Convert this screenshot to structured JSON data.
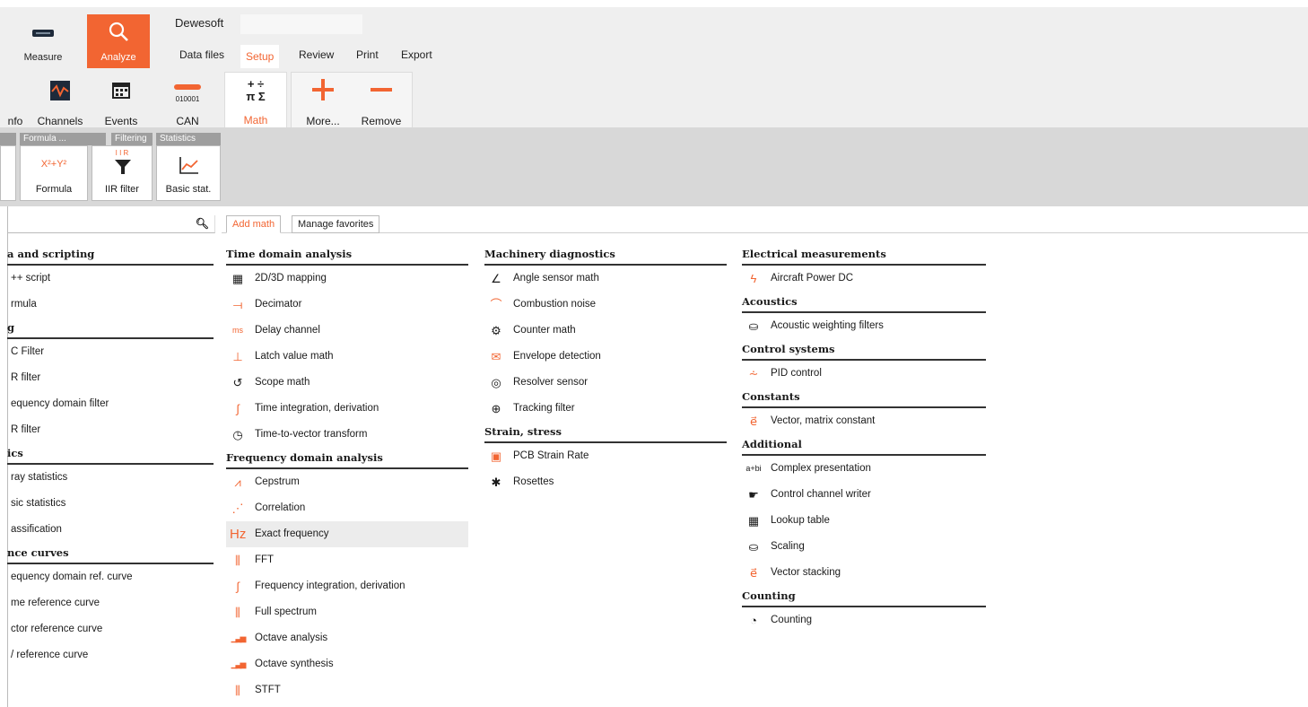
{
  "app": {
    "title": "Dewesoft"
  },
  "modes": [
    {
      "label": "Measure",
      "icon": "measure-icon"
    },
    {
      "label": "Analyze",
      "icon": "search-icon"
    }
  ],
  "menu_tabs": [
    "Data files",
    "Setup",
    "Review",
    "Print",
    "Export"
  ],
  "active_menu_tab": "Setup",
  "toolbar": {
    "info": "nfo",
    "channels": "Channels",
    "events": "Events",
    "can": "CAN",
    "can_sub": "010001",
    "math": "Math",
    "more": "More...",
    "remove": "Remove"
  },
  "ribbon_groups": {
    "formula_hdr": "Formula ...",
    "filtering_hdr": "Filtering",
    "statistics_hdr": "Statistics",
    "formula": "Formula",
    "formula_sym": "X²+Y²",
    "iir": "IIR filter",
    "iir_sym": "I I R",
    "basic": "Basic stat."
  },
  "tabs": {
    "add_math": "Add math",
    "manage_favorites": "Manage favorites"
  },
  "accent": "#f26532",
  "columns": [
    {
      "sections": [
        {
          "title": "a and scripting",
          "items": [
            "++ script",
            "rmula"
          ]
        },
        {
          "title": "g",
          "items": [
            "C Filter",
            "R filter",
            "equency domain filter",
            "R filter"
          ]
        },
        {
          "title": "ics",
          "items": [
            "ray statistics",
            "sic statistics",
            "assification"
          ]
        },
        {
          "title": "nce curves",
          "items": [
            "equency domain ref. curve",
            "me reference curve",
            "ctor reference curve",
            "/ reference curve"
          ]
        }
      ]
    },
    {
      "sections": [
        {
          "title": "Time domain analysis",
          "items": [
            "2D/3D mapping",
            "Decimator",
            "Delay channel",
            "Latch value math",
            "Scope math",
            "Time integration, derivation",
            "Time-to-vector transform"
          ]
        },
        {
          "title": "Frequency domain analysis",
          "items": [
            "Cepstrum",
            "Correlation",
            "Exact frequency",
            "FFT",
            "Frequency integration, derivation",
            "Full spectrum",
            "Octave analysis",
            "Octave synthesis",
            "STFT"
          ]
        }
      ]
    },
    {
      "sections": [
        {
          "title": "Machinery diagnostics",
          "items": [
            "Angle sensor math",
            "Combustion noise",
            "Counter math",
            "Envelope detection",
            "Resolver sensor",
            "Tracking filter"
          ]
        },
        {
          "title": "Strain, stress",
          "items": [
            "PCB Strain Rate",
            "Rosettes"
          ]
        }
      ]
    },
    {
      "sections": [
        {
          "title": "Electrical measurements",
          "items": [
            "Aircraft Power DC"
          ]
        },
        {
          "title": "Acoustics",
          "items": [
            "Acoustic weighting filters"
          ]
        },
        {
          "title": "Control systems",
          "items": [
            "PID control"
          ]
        },
        {
          "title": "Constants",
          "items": [
            "Vector, matrix constant"
          ]
        },
        {
          "title": "Additional",
          "items": [
            "Complex presentation",
            "Control channel writer",
            "Lookup table",
            "Scaling",
            "Vector stacking"
          ]
        },
        {
          "title": "Counting",
          "items": [
            "Counting"
          ]
        }
      ]
    }
  ],
  "selected_item": "Exact frequency",
  "icon_map": {
    "2D/3D mapping": [
      "grid-icon",
      "▦"
    ],
    "Decimator": [
      "decimator-icon",
      "⟞"
    ],
    "Delay channel": [
      "delay-icon",
      "ms"
    ],
    "Latch value math": [
      "latch-icon",
      "⊥"
    ],
    "Scope math": [
      "scope-icon",
      "↺"
    ],
    "Time integration, derivation": [
      "integral-icon",
      "∫"
    ],
    "Time-to-vector transform": [
      "clock-icon",
      "◷"
    ],
    "Cepstrum": [
      "cepstrum-icon",
      "⩘"
    ],
    "Correlation": [
      "correlation-icon",
      "⋰"
    ],
    "Exact frequency": [
      "hz-icon",
      "Hz"
    ],
    "FFT": [
      "fft-icon",
      "⫼"
    ],
    "Frequency integration, derivation": [
      "integral-icon",
      "∫"
    ],
    "Full spectrum": [
      "spectrum-icon",
      "⫼"
    ],
    "Octave analysis": [
      "octave-icon",
      "▁▃▅"
    ],
    "Octave synthesis": [
      "octave-icon",
      "▁▃▅"
    ],
    "STFT": [
      "stft-icon",
      "⫼"
    ],
    "Angle sensor math": [
      "angle-icon",
      "∠"
    ],
    "Combustion noise": [
      "combustion-icon",
      "⌒"
    ],
    "Counter math": [
      "gear-icon",
      "⚙"
    ],
    "Envelope detection": [
      "envelope-icon",
      "✉"
    ],
    "Resolver sensor": [
      "resolver-icon",
      "◎"
    ],
    "Tracking filter": [
      "crosshair-icon",
      "⊕"
    ],
    "PCB Strain Rate": [
      "chip-icon",
      "▣"
    ],
    "Rosettes": [
      "rosette-icon",
      "✱"
    ],
    "Aircraft Power DC": [
      "lightning-icon",
      "ϟ"
    ],
    "Acoustic weighting filters": [
      "weight-icon",
      "⛀"
    ],
    "PID control": [
      "pid-icon",
      "⩪"
    ],
    "Vector, matrix constant": [
      "vector-icon",
      "e⃗"
    ],
    "Complex presentation": [
      "complex-icon",
      "a+bi"
    ],
    "Control channel writer": [
      "pointer-icon",
      "☛"
    ],
    "Lookup table": [
      "table-icon",
      "▦"
    ],
    "Scaling": [
      "weight-icon",
      "⛀"
    ],
    "Vector stacking": [
      "vector-icon",
      "e⃗"
    ],
    "Counting": [
      "counter-icon",
      "◔"
    ]
  }
}
